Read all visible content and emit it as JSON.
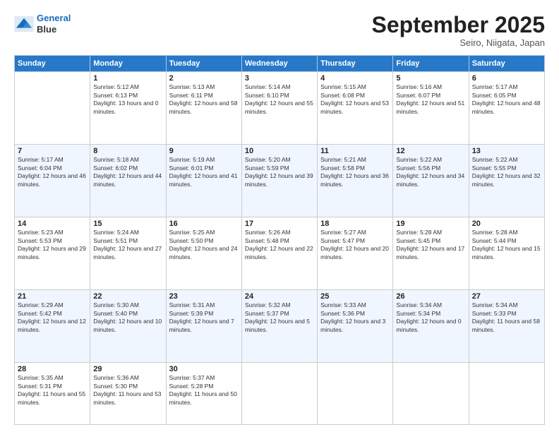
{
  "header": {
    "logo_line1": "General",
    "logo_line2": "Blue",
    "month_title": "September 2025",
    "location": "Seiro, Niigata, Japan"
  },
  "weekdays": [
    "Sunday",
    "Monday",
    "Tuesday",
    "Wednesday",
    "Thursday",
    "Friday",
    "Saturday"
  ],
  "weeks": [
    [
      {
        "day": "",
        "sunrise": "",
        "sunset": "",
        "daylight": ""
      },
      {
        "day": "1",
        "sunrise": "Sunrise: 5:12 AM",
        "sunset": "Sunset: 6:13 PM",
        "daylight": "Daylight: 13 hours and 0 minutes."
      },
      {
        "day": "2",
        "sunrise": "Sunrise: 5:13 AM",
        "sunset": "Sunset: 6:11 PM",
        "daylight": "Daylight: 12 hours and 58 minutes."
      },
      {
        "day": "3",
        "sunrise": "Sunrise: 5:14 AM",
        "sunset": "Sunset: 6:10 PM",
        "daylight": "Daylight: 12 hours and 55 minutes."
      },
      {
        "day": "4",
        "sunrise": "Sunrise: 5:15 AM",
        "sunset": "Sunset: 6:08 PM",
        "daylight": "Daylight: 12 hours and 53 minutes."
      },
      {
        "day": "5",
        "sunrise": "Sunrise: 5:16 AM",
        "sunset": "Sunset: 6:07 PM",
        "daylight": "Daylight: 12 hours and 51 minutes."
      },
      {
        "day": "6",
        "sunrise": "Sunrise: 5:17 AM",
        "sunset": "Sunset: 6:05 PM",
        "daylight": "Daylight: 12 hours and 48 minutes."
      }
    ],
    [
      {
        "day": "7",
        "sunrise": "Sunrise: 5:17 AM",
        "sunset": "Sunset: 6:04 PM",
        "daylight": "Daylight: 12 hours and 46 minutes."
      },
      {
        "day": "8",
        "sunrise": "Sunrise: 5:18 AM",
        "sunset": "Sunset: 6:02 PM",
        "daylight": "Daylight: 12 hours and 44 minutes."
      },
      {
        "day": "9",
        "sunrise": "Sunrise: 5:19 AM",
        "sunset": "Sunset: 6:01 PM",
        "daylight": "Daylight: 12 hours and 41 minutes."
      },
      {
        "day": "10",
        "sunrise": "Sunrise: 5:20 AM",
        "sunset": "Sunset: 5:59 PM",
        "daylight": "Daylight: 12 hours and 39 minutes."
      },
      {
        "day": "11",
        "sunrise": "Sunrise: 5:21 AM",
        "sunset": "Sunset: 5:58 PM",
        "daylight": "Daylight: 12 hours and 36 minutes."
      },
      {
        "day": "12",
        "sunrise": "Sunrise: 5:22 AM",
        "sunset": "Sunset: 5:56 PM",
        "daylight": "Daylight: 12 hours and 34 minutes."
      },
      {
        "day": "13",
        "sunrise": "Sunrise: 5:22 AM",
        "sunset": "Sunset: 5:55 PM",
        "daylight": "Daylight: 12 hours and 32 minutes."
      }
    ],
    [
      {
        "day": "14",
        "sunrise": "Sunrise: 5:23 AM",
        "sunset": "Sunset: 5:53 PM",
        "daylight": "Daylight: 12 hours and 29 minutes."
      },
      {
        "day": "15",
        "sunrise": "Sunrise: 5:24 AM",
        "sunset": "Sunset: 5:51 PM",
        "daylight": "Daylight: 12 hours and 27 minutes."
      },
      {
        "day": "16",
        "sunrise": "Sunrise: 5:25 AM",
        "sunset": "Sunset: 5:50 PM",
        "daylight": "Daylight: 12 hours and 24 minutes."
      },
      {
        "day": "17",
        "sunrise": "Sunrise: 5:26 AM",
        "sunset": "Sunset: 5:48 PM",
        "daylight": "Daylight: 12 hours and 22 minutes."
      },
      {
        "day": "18",
        "sunrise": "Sunrise: 5:27 AM",
        "sunset": "Sunset: 5:47 PM",
        "daylight": "Daylight: 12 hours and 20 minutes."
      },
      {
        "day": "19",
        "sunrise": "Sunrise: 5:28 AM",
        "sunset": "Sunset: 5:45 PM",
        "daylight": "Daylight: 12 hours and 17 minutes."
      },
      {
        "day": "20",
        "sunrise": "Sunrise: 5:28 AM",
        "sunset": "Sunset: 5:44 PM",
        "daylight": "Daylight: 12 hours and 15 minutes."
      }
    ],
    [
      {
        "day": "21",
        "sunrise": "Sunrise: 5:29 AM",
        "sunset": "Sunset: 5:42 PM",
        "daylight": "Daylight: 12 hours and 12 minutes."
      },
      {
        "day": "22",
        "sunrise": "Sunrise: 5:30 AM",
        "sunset": "Sunset: 5:40 PM",
        "daylight": "Daylight: 12 hours and 10 minutes."
      },
      {
        "day": "23",
        "sunrise": "Sunrise: 5:31 AM",
        "sunset": "Sunset: 5:39 PM",
        "daylight": "Daylight: 12 hours and 7 minutes."
      },
      {
        "day": "24",
        "sunrise": "Sunrise: 5:32 AM",
        "sunset": "Sunset: 5:37 PM",
        "daylight": "Daylight: 12 hours and 5 minutes."
      },
      {
        "day": "25",
        "sunrise": "Sunrise: 5:33 AM",
        "sunset": "Sunset: 5:36 PM",
        "daylight": "Daylight: 12 hours and 3 minutes."
      },
      {
        "day": "26",
        "sunrise": "Sunrise: 5:34 AM",
        "sunset": "Sunset: 5:34 PM",
        "daylight": "Daylight: 12 hours and 0 minutes."
      },
      {
        "day": "27",
        "sunrise": "Sunrise: 5:34 AM",
        "sunset": "Sunset: 5:33 PM",
        "daylight": "Daylight: 11 hours and 58 minutes."
      }
    ],
    [
      {
        "day": "28",
        "sunrise": "Sunrise: 5:35 AM",
        "sunset": "Sunset: 5:31 PM",
        "daylight": "Daylight: 11 hours and 55 minutes."
      },
      {
        "day": "29",
        "sunrise": "Sunrise: 5:36 AM",
        "sunset": "Sunset: 5:30 PM",
        "daylight": "Daylight: 11 hours and 53 minutes."
      },
      {
        "day": "30",
        "sunrise": "Sunrise: 5:37 AM",
        "sunset": "Sunset: 5:28 PM",
        "daylight": "Daylight: 11 hours and 50 minutes."
      },
      {
        "day": "",
        "sunrise": "",
        "sunset": "",
        "daylight": ""
      },
      {
        "day": "",
        "sunrise": "",
        "sunset": "",
        "daylight": ""
      },
      {
        "day": "",
        "sunrise": "",
        "sunset": "",
        "daylight": ""
      },
      {
        "day": "",
        "sunrise": "",
        "sunset": "",
        "daylight": ""
      }
    ]
  ]
}
